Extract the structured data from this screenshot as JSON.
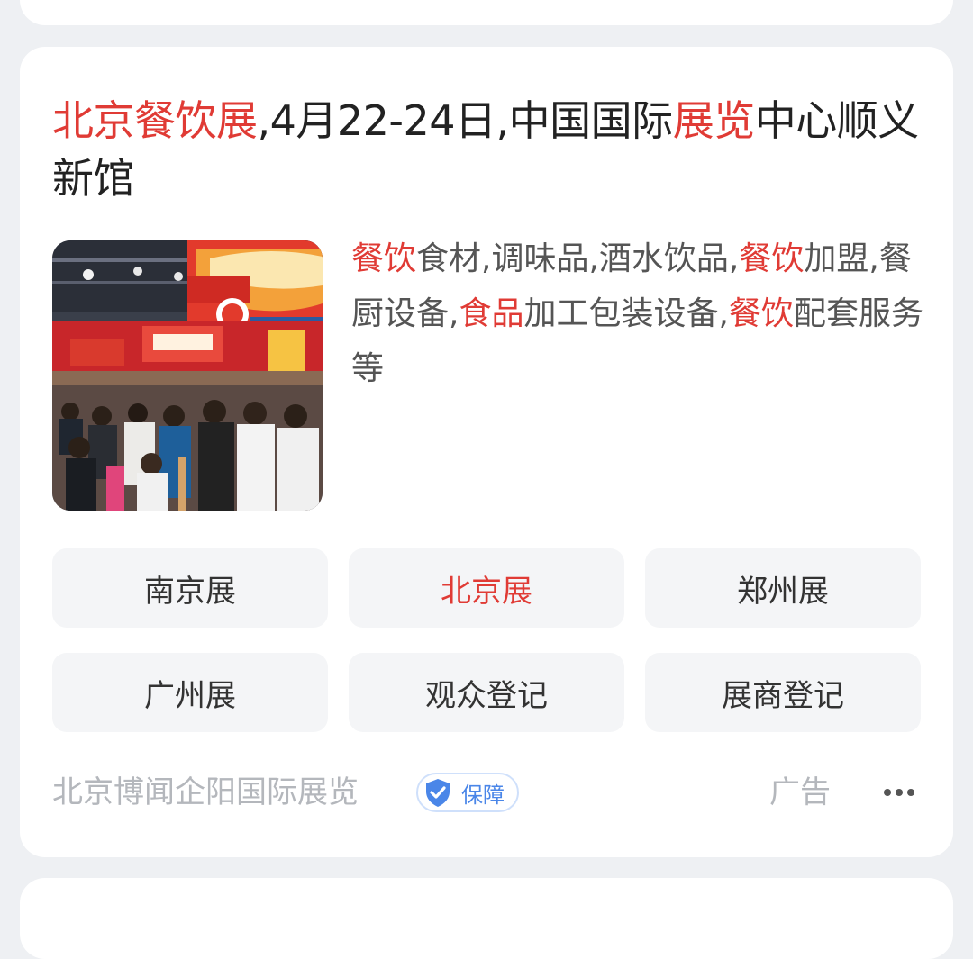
{
  "title": {
    "part1": "北京餐饮展",
    "part2": ",4月22-24日,中国国际",
    "part3": "展览",
    "part4": "中心顺义新馆"
  },
  "description": {
    "p1": "餐饮",
    "p2": "食材,调味品,酒水饮品,",
    "p3": "餐饮",
    "p4": "加盟,餐厨设备,",
    "p5": "食品",
    "p6": "加工包装设备,",
    "p7": "餐饮",
    "p8": "配套服务等"
  },
  "buttons": [
    {
      "label": "南京展"
    },
    {
      "label": "北京展"
    },
    {
      "label": "郑州展"
    },
    {
      "label": "广州展"
    },
    {
      "label": "观众登记"
    },
    {
      "label": "展商登记"
    }
  ],
  "footer": {
    "source": "北京博闻企阳国际展览",
    "badge": "保障",
    "ad_label": "广告"
  },
  "colors": {
    "highlight": "#e03b35",
    "badge_blue": "#4a86e8"
  },
  "icons": {
    "badge": "shield-check-icon",
    "more": "more-dots-icon"
  }
}
